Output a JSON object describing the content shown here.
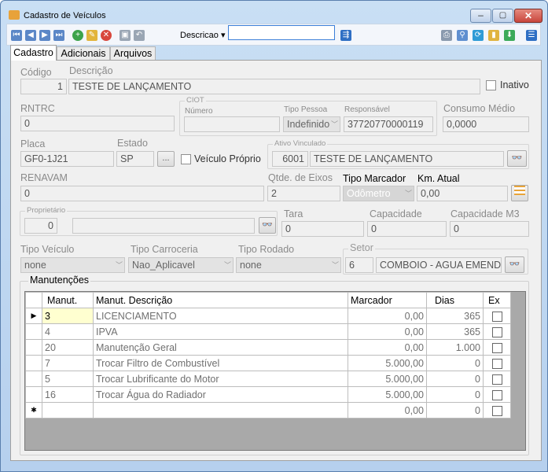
{
  "window": {
    "title": "Cadastro de Veículos"
  },
  "toolbar": {
    "search_field_label": "Descricao",
    "search_value": ""
  },
  "tabs": [
    {
      "label": "Cadastro"
    },
    {
      "label": "Adicionais"
    },
    {
      "label": "Arquivos"
    }
  ],
  "form": {
    "codigo_label": "Código",
    "codigo": "1",
    "descricao_label": "Descrição",
    "descricao": "TESTE DE LANÇAMENTO",
    "inativo_label": "Inativo",
    "rntrc_label": "RNTRC",
    "rntrc": "0",
    "ciot_label": "CIOT",
    "ciot_numero_label": "Número",
    "ciot_numero": "",
    "tipo_pessoa_label": "Tipo Pessoa",
    "tipo_pessoa": "Indefinido",
    "responsavel_label": "Responsável",
    "responsavel": "37720770000119",
    "consumo_label": "Consumo Médio",
    "consumo": "0,0000",
    "placa_label": "Placa",
    "placa": "GF0-1J21",
    "estado_label": "Estado",
    "estado": "SP",
    "estado_btn": "...",
    "veiculo_proprio_label": "Veículo Próprio",
    "ativo_label": "Ativo Vinculado",
    "ativo_codigo": "6001",
    "ativo_nome": "TESTE DE LANÇAMENTO",
    "renavam_label": "RENAVAM",
    "renavam": "0",
    "eixos_label": "Qtde. de Eixos",
    "eixos": "2",
    "tipo_marcador_label": "Tipo Marcador",
    "tipo_marcador": "Odômetro",
    "km_atual_label": "Km. Atual",
    "km_atual": "0,00",
    "proprietario_label": "Proprietário",
    "proprietario_codigo": "0",
    "proprietario_nome": "",
    "tara_label": "Tara",
    "tara": "0",
    "capacidade_label": "Capacidade",
    "capacidade": "0",
    "capacidade_m3_label": "Capacidade M3",
    "capacidade_m3": "0",
    "tipo_veiculo_label": "Tipo Veículo",
    "tipo_veiculo": "none",
    "tipo_carroceria_label": "Tipo Carroceria",
    "tipo_carroceria": "Nao_Aplicavel",
    "tipo_rodado_label": "Tipo Rodado",
    "tipo_rodado": "none",
    "setor_label": "Setor",
    "setor_codigo": "6",
    "setor_nome": "COMBOIO - AGUA EMENDA"
  },
  "manutencoes": {
    "title": "Manutenções",
    "columns": [
      "Manut.",
      "Manut. Descrição",
      "Marcador",
      "Dias",
      "Ex"
    ],
    "rows": [
      {
        "manut": "3",
        "descricao": "LICENCIAMENTO",
        "marcador": "0,00",
        "dias": "365"
      },
      {
        "manut": "4",
        "descricao": "IPVA",
        "marcador": "0,00",
        "dias": "365"
      },
      {
        "manut": "20",
        "descricao": "Manutenção Geral",
        "marcador": "0,00",
        "dias": "1.000"
      },
      {
        "manut": "7",
        "descricao": "Trocar Filtro de Combustível",
        "marcador": "5.000,00",
        "dias": "0"
      },
      {
        "manut": "5",
        "descricao": "Trocar Lubrificante do Motor",
        "marcador": "5.000,00",
        "dias": "0"
      },
      {
        "manut": "16",
        "descricao": "Trocar Água do Radiador",
        "marcador": "5.000,00",
        "dias": "0"
      }
    ],
    "new_row": {
      "marcador": "0,00",
      "dias": "0"
    }
  },
  "colors": {
    "accent": "#3c7fd8",
    "titlebar": "#c4daf3",
    "close_button": "#c9463d"
  }
}
